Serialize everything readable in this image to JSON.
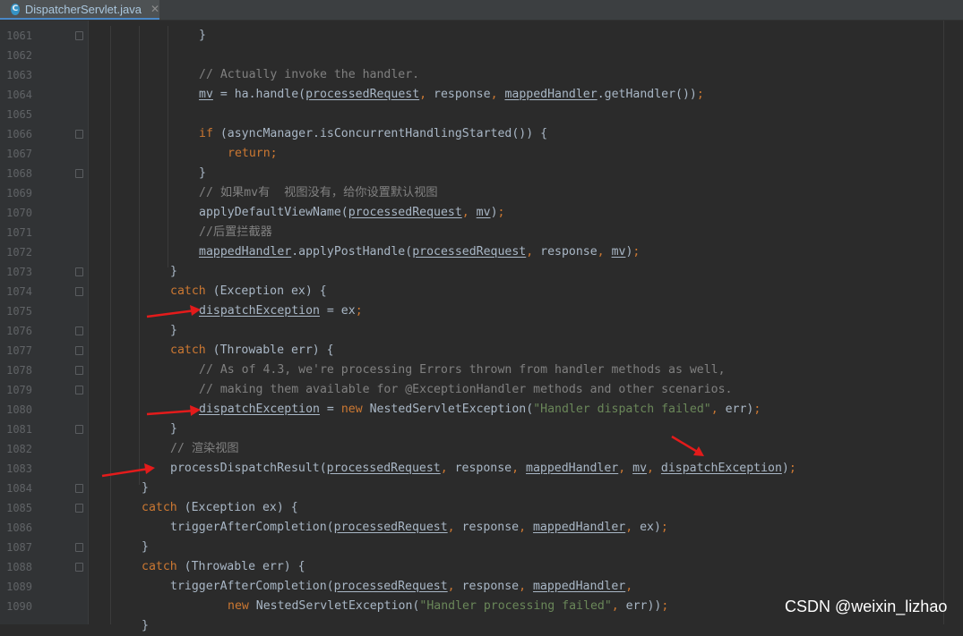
{
  "tab": {
    "icon_letter": "C",
    "title": "DispatcherServlet.java",
    "close": "✕"
  },
  "watermark": "CSDN @weixin_lizhao",
  "colors": {
    "keyword": "#cc7832",
    "comment": "#808080",
    "string": "#6a8759",
    "text": "#a9b7c6",
    "arrow": "#e31b1b"
  },
  "lines": [
    {
      "n": "1061",
      "fold": true,
      "code": [
        {
          "t": "}",
          "c": "plain"
        }
      ]
    },
    {
      "n": "1062",
      "fold": false,
      "code": []
    },
    {
      "n": "1063",
      "fold": false,
      "code": [
        {
          "t": "// Actually invoke the handler.",
          "c": "cm"
        }
      ]
    },
    {
      "n": "1064",
      "fold": false,
      "code": [
        {
          "t": "mv",
          "c": "fld"
        },
        {
          "t": " = ha.handle(",
          "c": "plain"
        },
        {
          "t": "processedRequest",
          "c": "fld"
        },
        {
          "t": ", ",
          "c": "kw"
        },
        {
          "t": "response",
          "c": "plain"
        },
        {
          "t": ", ",
          "c": "kw"
        },
        {
          "t": "mappedHandler",
          "c": "fld"
        },
        {
          "t": ".getHandler())",
          "c": "plain"
        },
        {
          "t": ";",
          "c": "kw"
        }
      ]
    },
    {
      "n": "1065",
      "fold": false,
      "code": []
    },
    {
      "n": "1066",
      "fold": true,
      "code": [
        {
          "t": "if ",
          "c": "kw"
        },
        {
          "t": "(asyncManager.isConcurrentHandlingStarted()) {",
          "c": "plain"
        }
      ]
    },
    {
      "n": "1067",
      "fold": false,
      "code": [
        {
          "t": "return;",
          "c": "kw"
        }
      ]
    },
    {
      "n": "1068",
      "fold": true,
      "code": [
        {
          "t": "}",
          "c": "plain"
        }
      ]
    },
    {
      "n": "1069",
      "fold": false,
      "code": [
        {
          "t": "// 如果mv有  视图没有，给你设置默认视图",
          "c": "cm"
        }
      ]
    },
    {
      "n": "1070",
      "fold": false,
      "code": [
        {
          "t": "applyDefaultViewName(",
          "c": "plain"
        },
        {
          "t": "processedRequest",
          "c": "fld"
        },
        {
          "t": ", ",
          "c": "kw"
        },
        {
          "t": "mv",
          "c": "fld"
        },
        {
          "t": ")",
          "c": "plain"
        },
        {
          "t": ";",
          "c": "kw"
        }
      ]
    },
    {
      "n": "1071",
      "fold": false,
      "code": [
        {
          "t": "//后置拦截器",
          "c": "cm"
        }
      ]
    },
    {
      "n": "1072",
      "fold": false,
      "code": [
        {
          "t": "mappedHandler",
          "c": "fld"
        },
        {
          "t": ".applyPostHandle(",
          "c": "plain"
        },
        {
          "t": "processedRequest",
          "c": "fld"
        },
        {
          "t": ", ",
          "c": "kw"
        },
        {
          "t": "response",
          "c": "plain"
        },
        {
          "t": ", ",
          "c": "kw"
        },
        {
          "t": "mv",
          "c": "fld"
        },
        {
          "t": ")",
          "c": "plain"
        },
        {
          "t": ";",
          "c": "kw"
        }
      ]
    },
    {
      "n": "1073",
      "fold": true,
      "code": [
        {
          "t": "}",
          "c": "plain"
        }
      ]
    },
    {
      "n": "1074",
      "fold": true,
      "code": [
        {
          "t": "catch ",
          "c": "kw"
        },
        {
          "t": "(Exception ex) {",
          "c": "plain"
        }
      ]
    },
    {
      "n": "1075",
      "fold": false,
      "code": [
        {
          "t": "dispatchException",
          "c": "fld"
        },
        {
          "t": " = ex",
          "c": "plain"
        },
        {
          "t": ";",
          "c": "kw"
        }
      ]
    },
    {
      "n": "1076",
      "fold": true,
      "code": [
        {
          "t": "}",
          "c": "plain"
        }
      ]
    },
    {
      "n": "1077",
      "fold": true,
      "code": [
        {
          "t": "catch ",
          "c": "kw"
        },
        {
          "t": "(Throwable err) {",
          "c": "plain"
        }
      ]
    },
    {
      "n": "1078",
      "fold": true,
      "code": [
        {
          "t": "// As of 4.3, we're processing Errors thrown from handler methods as well,",
          "c": "cm"
        }
      ]
    },
    {
      "n": "1079",
      "fold": true,
      "code": [
        {
          "t": "// making them available for @ExceptionHandler methods and other scenarios.",
          "c": "cm"
        }
      ]
    },
    {
      "n": "1080",
      "fold": false,
      "code": [
        {
          "t": "dispatchException",
          "c": "fld"
        },
        {
          "t": " = ",
          "c": "plain"
        },
        {
          "t": "new ",
          "c": "kw"
        },
        {
          "t": "NestedServletException(",
          "c": "plain"
        },
        {
          "t": "\"Handler dispatch failed\"",
          "c": "str"
        },
        {
          "t": ", ",
          "c": "kw"
        },
        {
          "t": "err)",
          "c": "plain"
        },
        {
          "t": ";",
          "c": "kw"
        }
      ]
    },
    {
      "n": "1081",
      "fold": true,
      "code": [
        {
          "t": "}",
          "c": "plain"
        }
      ]
    },
    {
      "n": "1082",
      "fold": false,
      "code": [
        {
          "t": "// 渲染视图",
          "c": "cm"
        }
      ]
    },
    {
      "n": "1083",
      "fold": false,
      "code": [
        {
          "t": "processDispatchResult(",
          "c": "plain"
        },
        {
          "t": "processedRequest",
          "c": "fld"
        },
        {
          "t": ", ",
          "c": "kw"
        },
        {
          "t": "response",
          "c": "plain"
        },
        {
          "t": ", ",
          "c": "kw"
        },
        {
          "t": "mappedHandler",
          "c": "fld"
        },
        {
          "t": ", ",
          "c": "kw"
        },
        {
          "t": "mv",
          "c": "fld"
        },
        {
          "t": ", ",
          "c": "kw"
        },
        {
          "t": "dispatchException",
          "c": "fld"
        },
        {
          "t": ")",
          "c": "plain"
        },
        {
          "t": ";",
          "c": "kw"
        }
      ]
    },
    {
      "n": "1084",
      "fold": true,
      "code": [
        {
          "t": "}",
          "c": "plain"
        }
      ]
    },
    {
      "n": "1085",
      "fold": true,
      "code": [
        {
          "t": "catch ",
          "c": "kw"
        },
        {
          "t": "(Exception ex) {",
          "c": "plain"
        }
      ]
    },
    {
      "n": "1086",
      "fold": false,
      "code": [
        {
          "t": "triggerAfterCompletion(",
          "c": "plain"
        },
        {
          "t": "processedRequest",
          "c": "fld"
        },
        {
          "t": ", ",
          "c": "kw"
        },
        {
          "t": "response",
          "c": "plain"
        },
        {
          "t": ", ",
          "c": "kw"
        },
        {
          "t": "mappedHandler",
          "c": "fld"
        },
        {
          "t": ", ",
          "c": "kw"
        },
        {
          "t": "ex)",
          "c": "plain"
        },
        {
          "t": ";",
          "c": "kw"
        }
      ]
    },
    {
      "n": "1087",
      "fold": true,
      "code": [
        {
          "t": "}",
          "c": "plain"
        }
      ]
    },
    {
      "n": "1088",
      "fold": true,
      "code": [
        {
          "t": "catch ",
          "c": "kw"
        },
        {
          "t": "(Throwable err) {",
          "c": "plain"
        }
      ]
    },
    {
      "n": "1089",
      "fold": false,
      "code": [
        {
          "t": "triggerAfterCompletion(",
          "c": "plain"
        },
        {
          "t": "processedRequest",
          "c": "fld"
        },
        {
          "t": ", ",
          "c": "kw"
        },
        {
          "t": "response",
          "c": "plain"
        },
        {
          "t": ", ",
          "c": "kw"
        },
        {
          "t": "mappedHandler",
          "c": "fld"
        },
        {
          "t": ",",
          "c": "kw"
        }
      ]
    },
    {
      "n": "1090",
      "fold": false,
      "code": [
        {
          "t": "new ",
          "c": "kw"
        },
        {
          "t": "NestedServletException(",
          "c": "plain"
        },
        {
          "t": "\"Handler processing failed\"",
          "c": "str"
        },
        {
          "t": ", ",
          "c": "kw"
        },
        {
          "t": "err))",
          "c": "plain"
        },
        {
          "t": ";",
          "c": "kw"
        }
      ]
    },
    {
      "n": "",
      "fold": false,
      "code": [
        {
          "t": "}",
          "c": "plain"
        }
      ]
    }
  ]
}
